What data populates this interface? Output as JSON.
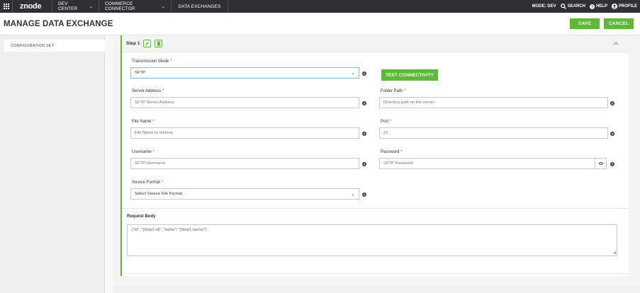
{
  "nav": {
    "logo": "znode",
    "items": [
      {
        "label": "DEV CENTER",
        "caret": "⌄"
      },
      {
        "label": "COMMERCE CONNECTOR",
        "caret": "⌄"
      },
      {
        "label": "DATA EXCHANGES"
      }
    ],
    "mode": "MODE: DEV",
    "search": "SEARCH",
    "help": "HELP",
    "profile": "PROFILE"
  },
  "page": {
    "title": "MANAGE DATA EXCHANGE",
    "save_label": "SAVE",
    "cancel_label": "CANCEL"
  },
  "sidebar": {
    "items": [
      {
        "label": "CONFIGURATION SET"
      }
    ]
  },
  "step": {
    "title": "Step 1",
    "fields": {
      "transmission_mode": {
        "label": "Transmission Mode",
        "value": "SFTP"
      },
      "test_label": "TEST CONNECTIVITY",
      "server_address": {
        "label": "Server Address",
        "placeholder": "SFTP Server Address"
      },
      "folder_path": {
        "label": "Folder Path",
        "placeholder": "Directory path on the server"
      },
      "file_name": {
        "label": "File Name",
        "placeholder": "File Name to retrieve"
      },
      "port": {
        "label": "Port",
        "value": "22"
      },
      "username": {
        "label": "Username",
        "placeholder": "SFTP Username"
      },
      "password": {
        "label": "Password",
        "placeholder": "SFTP Password"
      },
      "source_format": {
        "label": "Source Format",
        "value": "Select Source File Format"
      }
    },
    "request_body": {
      "label": "Request Body",
      "value": "{\"id\": \"{Step1.id}\", \"name\": \"{Step1.name}\"}"
    }
  },
  "colors": {
    "accent": "#5db93a",
    "nav_bg": "#2e3033",
    "required": "#e0352b"
  }
}
